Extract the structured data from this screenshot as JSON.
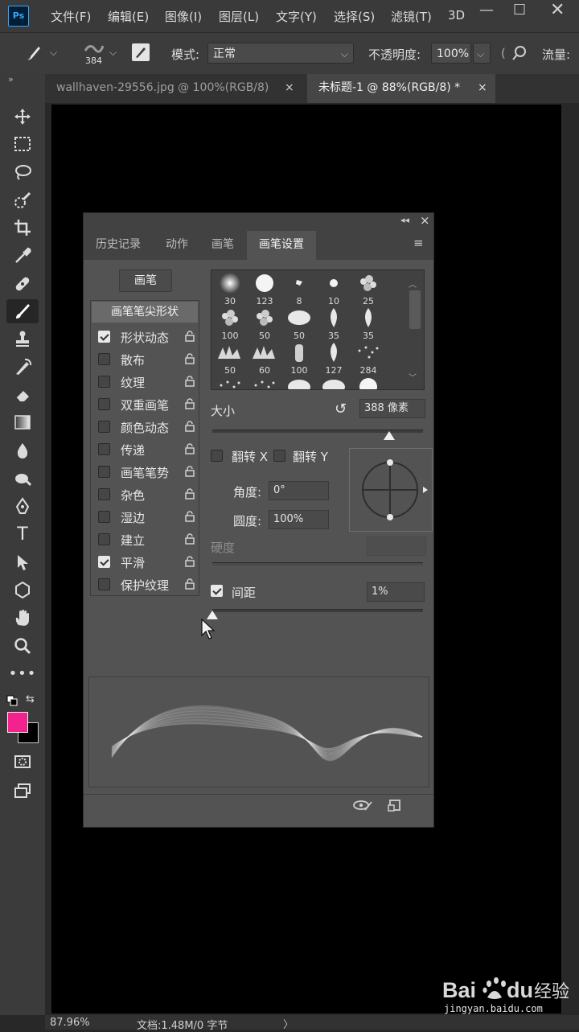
{
  "app": {
    "logo": "Ps",
    "menus": [
      "文件(F)",
      "编辑(E)",
      "图像(I)",
      "图层(L)",
      "文字(Y)",
      "选择(S)",
      "滤镜(T)",
      "3D"
    ]
  },
  "options_bar": {
    "brush_size": "384",
    "mode_label": "模式:",
    "mode_value": "正常",
    "opacity_label": "不透明度:",
    "opacity_value": "100%",
    "flow_label": "流量:"
  },
  "tabs": [
    {
      "label": "wallhaven-29556.jpg @ 100%(RGB/8)",
      "close": "×",
      "active": false
    },
    {
      "label": "未标题-1 @ 88%(RGB/8) *",
      "close": "×",
      "active": true
    }
  ],
  "toolbar": {
    "tools": [
      "move-tool-icon",
      "marquee-tool-icon",
      "lasso-tool-icon",
      "quick-select-tool-icon",
      "crop-tool-icon",
      "eyedropper-tool-icon",
      "healing-brush-tool-icon",
      "brush-tool-icon",
      "stamp-tool-icon",
      "history-brush-tool-icon",
      "eraser-tool-icon",
      "gradient-tool-icon",
      "blur-tool-icon",
      "dodge-tool-icon",
      "pen-tool-icon",
      "type-tool-icon",
      "path-select-tool-icon",
      "shape-tool-icon",
      "hand-tool-icon",
      "zoom-tool-icon",
      "more-tools-icon"
    ],
    "foreground_color": "#f2238f",
    "background_color": "#000000",
    "type_glyph": "T"
  },
  "panel": {
    "tabs": [
      "历史记录",
      "动作",
      "画笔",
      "画笔设置"
    ],
    "active_tab": 3,
    "brush_button": "画笔",
    "tip_shape_header": "画笔笔尖形状",
    "options": [
      {
        "label": "形状动态",
        "checked": true
      },
      {
        "label": "散布",
        "checked": false
      },
      {
        "label": "纹理",
        "checked": false
      },
      {
        "label": "双重画笔",
        "checked": false
      },
      {
        "label": "颜色动态",
        "checked": false
      },
      {
        "label": "传递",
        "checked": false
      },
      {
        "label": "画笔笔势",
        "checked": false
      },
      {
        "label": "杂色",
        "checked": false
      },
      {
        "label": "湿边",
        "checked": false
      },
      {
        "label": "建立",
        "checked": false
      },
      {
        "label": "平滑",
        "checked": true
      },
      {
        "label": "保护纹理",
        "checked": false
      }
    ],
    "brush_tips": [
      "30",
      "123",
      "8",
      "10",
      "25",
      "100",
      "50",
      "50",
      "35",
      "35",
      "50",
      "60",
      "100",
      "127",
      "284",
      "",
      "",
      "",
      "",
      ""
    ],
    "size_label": "大小",
    "size_value": "388 像素",
    "size_slider_fraction": 0.84,
    "flip_x_label": "翻转 X",
    "flip_y_label": "翻转 Y",
    "angle_label": "角度:",
    "angle_value": "0°",
    "roundness_label": "圆度:",
    "roundness_value": "100%",
    "hardness_label": "硬度",
    "spacing_label": "间距",
    "spacing_checked": true,
    "spacing_value": "1%",
    "spacing_slider_fraction": 0.0
  },
  "status": {
    "zoom": "87.96%",
    "doc_info": "文档:1.48M/0 字节",
    "arrow": "〉"
  },
  "watermark": {
    "brand": "Bai du 经验",
    "url": "jingyan.baidu.com"
  }
}
